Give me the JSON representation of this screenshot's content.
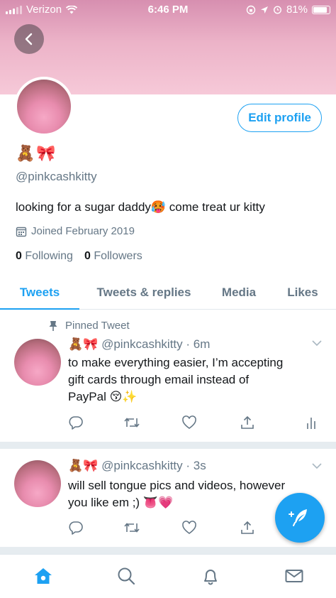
{
  "status_bar": {
    "carrier": "Verizon",
    "time": "6:46 PM",
    "battery": "81%"
  },
  "profile": {
    "emojis": "🧸🎀",
    "handle": "@pinkcashkitty",
    "bio": "looking for a sugar daddy🥵 come treat ur kitty",
    "joined": "Joined February 2019",
    "following_count": "0",
    "following_label": "Following",
    "followers_count": "0",
    "followers_label": "Followers",
    "edit_profile_label": "Edit profile"
  },
  "tabs": [
    {
      "label": "Tweets",
      "active": true
    },
    {
      "label": "Tweets & replies",
      "active": false
    },
    {
      "label": "Media",
      "active": false
    },
    {
      "label": "Likes",
      "active": false
    }
  ],
  "tweets": [
    {
      "pinned_label": "Pinned Tweet",
      "emojis": "🧸🎀",
      "handle": "@pinkcashkitty",
      "time": "· 6m",
      "line1": "to make everything easier, I’m accepting",
      "line2": "gift cards through email instead of",
      "line3": "PayPal 😚✨"
    },
    {
      "emojis": "🧸🎀",
      "handle": "@pinkcashkitty",
      "time": "· 3s",
      "line1": "will sell tongue pics and videos, however",
      "line2": "you like em ;) 👅💗"
    }
  ],
  "icons": {
    "back": "back-arrow-icon",
    "calendar": "calendar-icon",
    "pin": "pin-icon",
    "reply": "reply-icon",
    "retweet": "retweet-icon",
    "like": "heart-icon",
    "share": "share-icon",
    "analytics": "analytics-icon",
    "compose": "compose-feather-icon",
    "home": "home-icon",
    "search": "search-icon",
    "notifications": "bell-icon",
    "messages": "mail-icon"
  },
  "colors": {
    "accent": "#1da1f2",
    "header_pink": "#ecb3c8",
    "muted_text": "#657786"
  }
}
